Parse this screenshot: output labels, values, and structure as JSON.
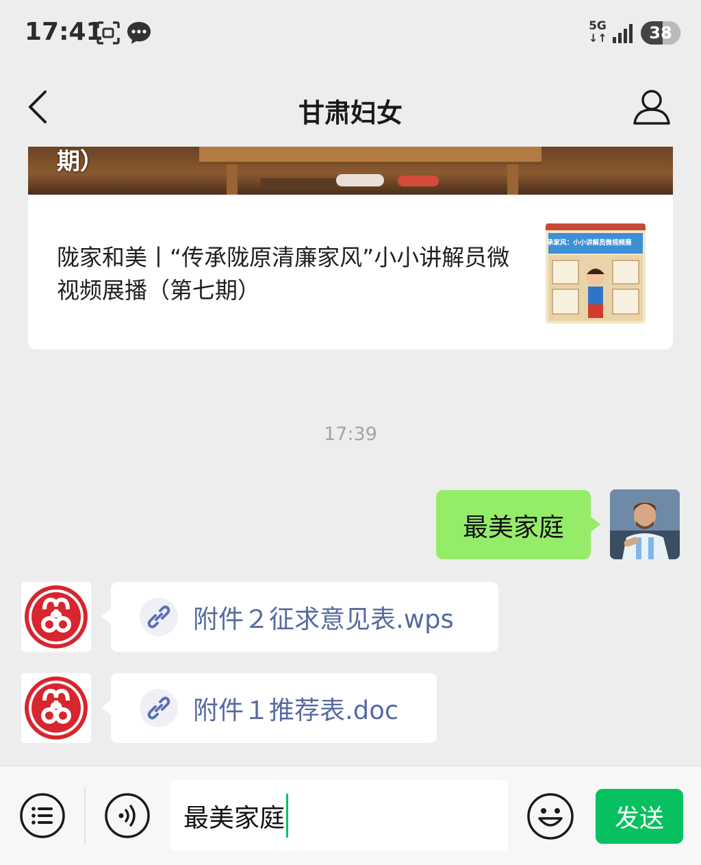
{
  "status_bar": {
    "time": "17:41",
    "network": "5G",
    "battery": "38"
  },
  "nav": {
    "title": "甘肃妇女"
  },
  "article": {
    "banner_text": "期）",
    "title": "陇家和美丨“传承陇原清廉家风”小小讲解员微视频展播（第七期）",
    "thumb_caption": "承家风：小小讲解员微视频展"
  },
  "timestamp": "17:39",
  "outgoing_message": {
    "text": "最美家庭"
  },
  "incoming_messages": [
    {
      "file_name": "附件２征求意见表.wps"
    },
    {
      "file_name": "附件１推荐表.doc"
    }
  ],
  "input_bar": {
    "text": "最美家庭",
    "send_label": "发送"
  }
}
